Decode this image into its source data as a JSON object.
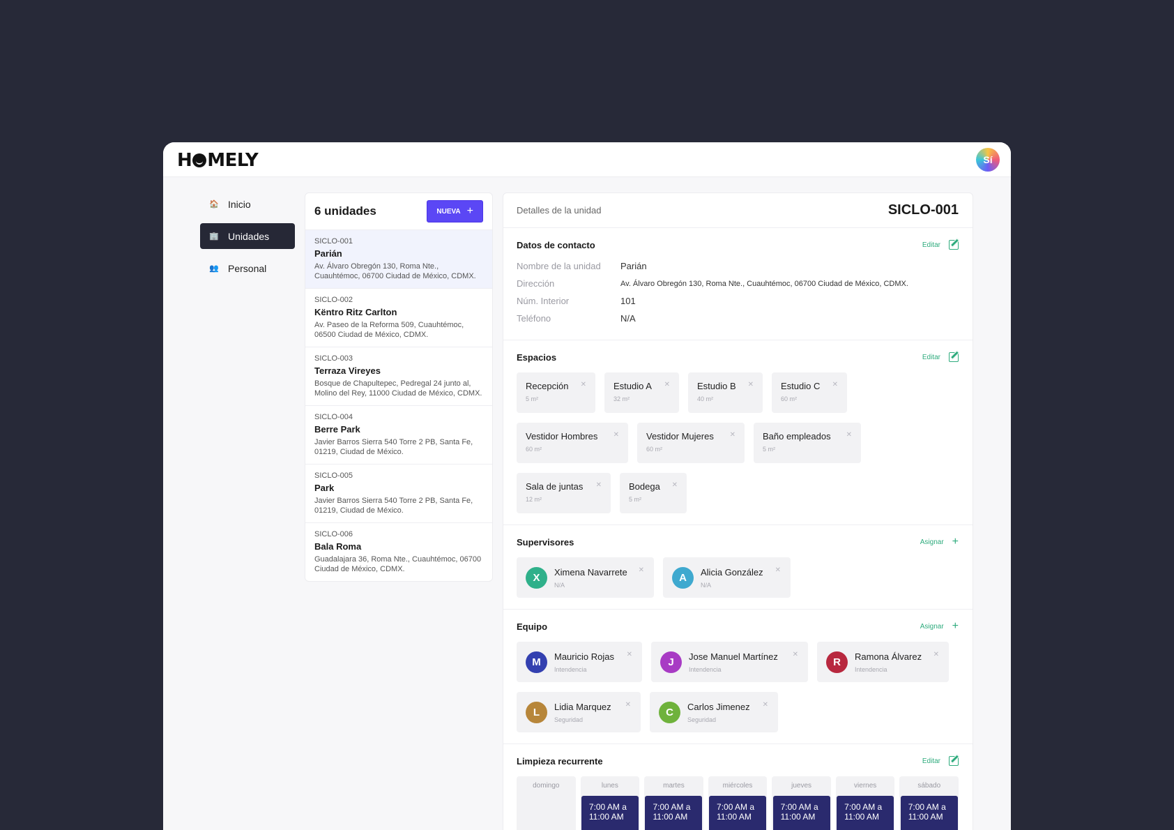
{
  "app": {
    "logo": "HOMELY",
    "user_initials": "Sí"
  },
  "nav": [
    {
      "label": "Inicio",
      "icon": "house-emoji-icon",
      "active": false
    },
    {
      "label": "Unidades",
      "icon": "office-building-icon",
      "active": true
    },
    {
      "label": "Personal",
      "icon": "people-emoji-icon",
      "active": false
    }
  ],
  "list": {
    "title": "6 unidades",
    "new_button": "NUEVA",
    "units": [
      {
        "code": "SICLO-001",
        "name": "Parián",
        "address": "Av. Álvaro Obregón 130, Roma Nte., Cuauhtémoc, 06700 Ciudad de México, CDMX."
      },
      {
        "code": "SICLO-002",
        "name": "Këntro Ritz Carlton",
        "address": "Av. Paseo de la Reforma 509, Cuauhtémoc, 06500 Ciudad de México, CDMX."
      },
      {
        "code": "SICLO-003",
        "name": "Terraza Vireyes",
        "address": "Bosque de Chapultepec, Pedregal 24 junto al, Molino del Rey, 11000 Ciudad de México, CDMX."
      },
      {
        "code": "SICLO-004",
        "name": "Berre Park",
        "address": "Javier Barros Sierra 540 Torre 2 PB, Santa Fe, 01219, Ciudad de México."
      },
      {
        "code": "SICLO-005",
        "name": "Park",
        "address": "Javier Barros Sierra 540 Torre 2 PB, Santa Fe, 01219, Ciudad de México."
      },
      {
        "code": "SICLO-006",
        "name": "Bala Roma",
        "address": "Guadalajara 36, Roma Nte., Cuauhtémoc, 06700 Ciudad de México, CDMX."
      }
    ]
  },
  "detail": {
    "subtitle": "Detalles de la unidad",
    "code": "SICLO-001",
    "contact": {
      "title": "Datos de contacto",
      "action": "Editar",
      "fields": [
        {
          "key": "Nombre de la unidad",
          "value": "Parián"
        },
        {
          "key": "Dirección",
          "value": "Av. Álvaro Obregón 130, Roma Nte., Cuauhtémoc, 06700 Ciudad de México, CDMX."
        },
        {
          "key": "Núm. Interior",
          "value": "101"
        },
        {
          "key": "Teléfono",
          "value": "N/A"
        }
      ]
    },
    "spaces": {
      "title": "Espacios",
      "action": "Editar",
      "items": [
        {
          "name": "Recepción",
          "size": "5 m²"
        },
        {
          "name": "Estudio A",
          "size": "32 m²"
        },
        {
          "name": "Estudio B",
          "size": "40 m²"
        },
        {
          "name": "Estudio C",
          "size": "60 m²"
        },
        {
          "name": "Vestidor Hombres",
          "size": "60 m²"
        },
        {
          "name": "Vestidor Mujeres",
          "size": "60 m²"
        },
        {
          "name": "Baño empleados",
          "size": "5 m²"
        },
        {
          "name": "Sala de juntas",
          "size": "12 m²"
        },
        {
          "name": "Bodega",
          "size": "5 m²"
        }
      ]
    },
    "supervisors": {
      "title": "Supervisores",
      "action": "Asignar",
      "people": [
        {
          "initial": "X",
          "name": "Ximena Navarrete",
          "role": "N/A",
          "color": "#2fb08a"
        },
        {
          "initial": "A",
          "name": "Alicia González",
          "role": "N/A",
          "color": "#3fa9cf"
        }
      ]
    },
    "team": {
      "title": "Equipo",
      "action": "Asignar",
      "people": [
        {
          "initial": "M",
          "name": "Mauricio Rojas",
          "role": "Intendencia",
          "color": "#3340b0"
        },
        {
          "initial": "J",
          "name": "Jose Manuel Martínez",
          "role": "Intendencia",
          "color": "#a83bc4"
        },
        {
          "initial": "R",
          "name": "Ramona Álvarez",
          "role": "Intendencia",
          "color": "#b8283f"
        },
        {
          "initial": "L",
          "name": "Lidia Marquez",
          "role": "Seguridad",
          "color": "#b7863a"
        },
        {
          "initial": "C",
          "name": "Carlos Jimenez",
          "role": "Seguridad",
          "color": "#6fb23c"
        }
      ]
    },
    "cleaning": {
      "title": "Limpieza recurrente",
      "action": "Editar",
      "days": [
        {
          "day": "domingo",
          "slot": ""
        },
        {
          "day": "lunes",
          "slot": "7:00 AM a 11:00 AM"
        },
        {
          "day": "martes",
          "slot": "7:00 AM a 11:00 AM"
        },
        {
          "day": "miércoles",
          "slot": "7:00 AM a 11:00 AM"
        },
        {
          "day": "jueves",
          "slot": "7:00 AM a 11:00 AM"
        },
        {
          "day": "viernes",
          "slot": "7:00 AM a 11:00 AM"
        },
        {
          "day": "sábado",
          "slot": "7:00 AM a 11:00 AM"
        }
      ]
    }
  }
}
